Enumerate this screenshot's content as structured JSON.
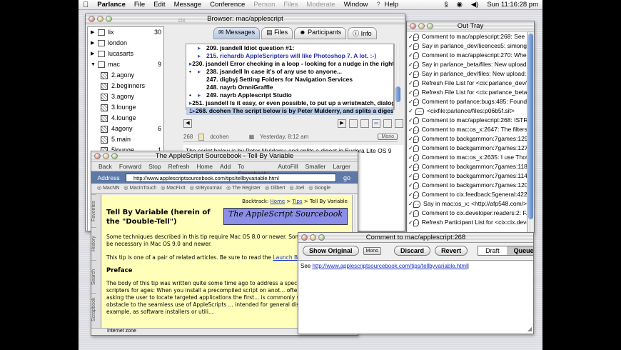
{
  "menubar": {
    "items": [
      "Parlance",
      "File",
      "Edit",
      "Message",
      "Conference",
      "Person",
      "Files",
      "Moderate",
      "Window",
      "Help"
    ],
    "dimmed": [
      "Person",
      "Files",
      "Moderate"
    ],
    "clock": "Sun 11:16:28 pm"
  },
  "browser": {
    "title": "Browser: mac/applescript",
    "tabs": [
      "Messages",
      "Files",
      "Participants",
      "Info"
    ],
    "tree": [
      {
        "label": "lix",
        "count": "30",
        "kind": "folder",
        "open": false
      },
      {
        "label": "london",
        "count": "",
        "kind": "folder",
        "open": false
      },
      {
        "label": "lucasarts",
        "count": "",
        "kind": "folder",
        "open": false
      },
      {
        "label": "mac",
        "count": "9",
        "kind": "folder",
        "open": true
      },
      {
        "label": "2.agony",
        "count": "",
        "kind": "topic"
      },
      {
        "label": "2.beginners",
        "count": "",
        "kind": "topic"
      },
      {
        "label": "3.agony",
        "count": "",
        "kind": "topic"
      },
      {
        "label": "3.lounge",
        "count": "",
        "kind": "topic"
      },
      {
        "label": "4.lounge",
        "count": "",
        "kind": "topic"
      },
      {
        "label": "4agony",
        "count": "6",
        "kind": "topic"
      },
      {
        "label": "5.main",
        "count": "",
        "kind": "topic"
      },
      {
        "label": "5lounge",
        "count": "1",
        "kind": "topic"
      },
      {
        "label": "6.main",
        "count": "",
        "kind": "topic"
      },
      {
        "label": "apple_uk",
        "count": "",
        "kind": "topic"
      }
    ],
    "messages": [
      {
        "b1": "",
        "b2": "▸",
        "text": "209. jsandell Idiot question #1:",
        "blue": false
      },
      {
        "b1": "",
        "b2": "▸",
        "text": "215. richardb AppleScripters will like Photoshop 7. A lot. :-)",
        "blue": true
      },
      {
        "b1": "",
        "b2": "▸",
        "text": "230. jsandell Error checking in a loop - looking for a nudge in the right ...",
        "blue": false
      },
      {
        "b1": "•",
        "b2": "▸",
        "text": "238. jsandell In case it's of any use to anyone...",
        "blue": false
      },
      {
        "b1": "",
        "b2": "",
        "text": "247. digbyj Setting Folders for Navigation Services",
        "blue": false
      },
      {
        "b1": "",
        "b2": "",
        "text": "248. nayrb OmniGraffle",
        "blue": false
      },
      {
        "b1": "•",
        "b2": "▸",
        "text": "249. nayrb Applescript Studio",
        "blue": false
      },
      {
        "b1": "",
        "b2": "▸",
        "text": "251. jsandell Is it easy, or even possible, to put up a wristwatch, dialog ...",
        "blue": false
      },
      {
        "b1": "1",
        "b2": "▸",
        "text": "268. dcohen The script below is by Peter Mulderry, and splits a digest in...",
        "blue": false,
        "selected": true
      }
    ],
    "header": {
      "num": "268",
      "author": "dcohen",
      "date": "Yesterday, 8:12 am",
      "mono": "Mono"
    },
    "body_lines": [
      "The script below is by Peter Mulderry, and splits a digest in Eudora Lite OS 9",
      "...nd it extremely useful and would",
      "...a script. Can any",
      "...OS X. It",
      "",
      "",
      "... the whole",
      "",
      "...whose"
    ]
  },
  "ie": {
    "title": "The AppleScript Sourcebook - Tell By Variable",
    "toolbar": [
      "Back",
      "Forward",
      "Stop",
      "Refresh",
      "Home",
      "Add",
      "To Scrapbook",
      "AutoFill",
      "Smaller",
      "Larger"
    ],
    "address_label": "Address",
    "url": "http://www.applescriptsourcebook.com/tips/tellbyvariable.html",
    "go": "go",
    "favorites": [
      "MacNN",
      "MacInTouch",
      "MacFixIt",
      "strByournac",
      "The Register",
      "Dilbert",
      "Joel",
      "Google"
    ],
    "sidetabs": [
      "Favorites",
      "History",
      "Search",
      "Scrapbook"
    ],
    "status": "Internet zone",
    "breadcrumb_prefix": "Backtrack:",
    "breadcrumb": [
      "Home",
      "Tips",
      "Tell By Variable"
    ],
    "logo": "The AppleScript Sourcebook",
    "heading": "Tell By Variable (herein of the \"Double-Tell\")",
    "p1": "Some techniques described in this tip require Mac OS 8.0 or newer. Some of ... may not be necessary in Mac OS 9.0 and newer.",
    "p2a": "This tip is one of a pair of related articles. Be sure to read the",
    "p2link": "Launch By C...",
    "preface": "Preface",
    "p3": "The body of this tip was written quite some time ago to address a specific p... frustrated scripters for ages: When you install a precompiled script on anot... often poses a dialog asking the user to locate targeted applications the first... is commonly seen as raising an obstacle to the seamless use of AppleScripts ... intended for general distribution, for example, as software installers or utili..."
  },
  "tray": {
    "title": "Out Tray",
    "items": [
      "Comment to mac/applescript:268: See ht...",
      "Say in parlance_dev/licences5: simong",
      "Comment to mac/applescript:270: When ...",
      "Say in parlance_beta/files: New upload:...",
      "Say in parlance_dev/files: New upload:...",
      "Refresh File List for <cix:parlance_dev/fi...",
      "Refresh File List for <cix:parlance_beta/f...",
      "Comment to parlance:bugs:485: Found a...",
      "<cixfile:parlance/files:p06b5f.sit>",
      "Comment to mac/applescript:268: ISTR th...",
      "Comment to mac:os_x:2647: The filters a...",
      "Comment to backgammon:7games:129: r...",
      "Comment to backgammon:7games:127: r...",
      "Comment to mac:os_x:2635: I use Thoth...",
      "Comment to backgammon:7games:118: r...",
      "Comment to backgammon:7games:114: ...",
      "Comment to backgammon:7games:120: r...",
      "Comment to cix.feedback:5general:4220...",
      "Say in mac:os_x: <http://afp548.com/>",
      "Comment to cix.developer:readers:2: F...",
      "Refresh Participant List for <cix:cix.devel..."
    ]
  },
  "comment": {
    "title": "Comment to mac/applescript:268",
    "buttons": [
      "Show Original",
      "Mono",
      "Discard",
      "Revert",
      "Draft",
      "Queued"
    ],
    "prefix": "See",
    "link": "http://www.applescriptsourcebook.com/tips/tellbyvariable.html"
  },
  "watermark": "mt",
  "cix": "cix"
}
